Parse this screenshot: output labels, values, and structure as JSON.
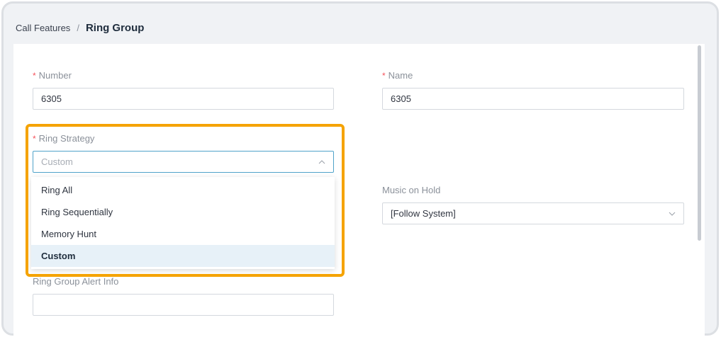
{
  "breadcrumb": {
    "parent": "Call Features",
    "separator": "/",
    "current": "Ring Group"
  },
  "form": {
    "number": {
      "label": "Number",
      "value": "6305"
    },
    "name": {
      "label": "Name",
      "value": "6305"
    },
    "ring_strategy": {
      "label": "Ring Strategy",
      "placeholder": "Custom",
      "options": [
        "Ring All",
        "Ring Sequentially",
        "Memory Hunt",
        "Custom"
      ],
      "selected": "Custom"
    },
    "music_on_hold": {
      "label": "Music on Hold",
      "value": "[Follow System]"
    },
    "alert_info": {
      "label": "Ring Group Alert Info",
      "value": ""
    },
    "required_marker": "*"
  },
  "colors": {
    "highlight": "#f5a300",
    "required": "#f5525c",
    "focus_border": "#4fa3c9",
    "selected_option_bg": "#e7f1f8"
  },
  "icons": {
    "open_caret": "chevron-up-icon",
    "closed_caret": "chevron-down-icon"
  }
}
